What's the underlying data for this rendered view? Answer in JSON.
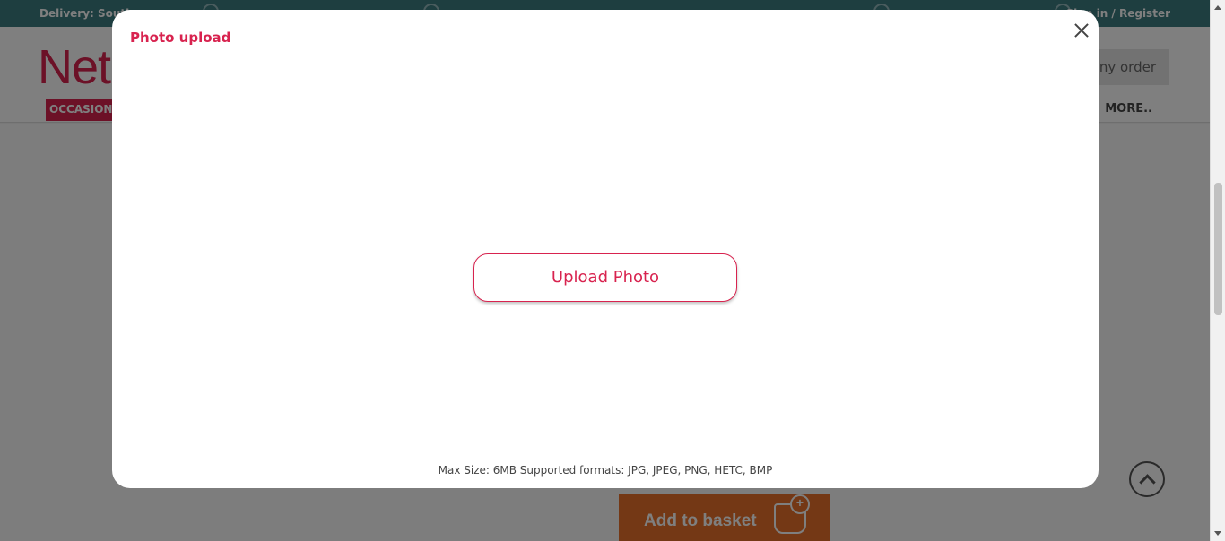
{
  "background": {
    "topbar": {
      "delivery_label": "Delivery: South",
      "signin_label": "Sign in / Register"
    },
    "header": {
      "logo_text": "Net",
      "track_order_label": "ny order"
    },
    "nav": {
      "occasions_label": "OCCASION",
      "more_label": "MORE.."
    },
    "add_to_basket_label": "Add to basket"
  },
  "modal": {
    "title": "Photo upload",
    "upload_button_label": "Upload Photo",
    "hint": "Max Size: 6MB Supported formats: JPG, JPEG, PNG, HETC, BMP"
  },
  "icons": {
    "close": "close-icon",
    "scroll_top": "chevron-up-icon",
    "cart": "cart-add-icon"
  },
  "colors": {
    "brand": "#d8234f",
    "topbar": "#3d7c80",
    "basket": "#e8712a"
  }
}
